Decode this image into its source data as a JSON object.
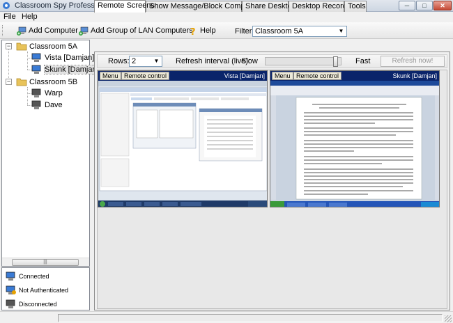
{
  "window": {
    "title": "Classroom Spy Professional",
    "min_glyph": "─",
    "max_glyph": "□",
    "close_glyph": "✕"
  },
  "menu": [
    "File",
    "Help"
  ],
  "toolbar": {
    "add_computer": "Add Computer",
    "add_group": "Add Group of LAN Computers",
    "help": "Help",
    "filter_label": "Filter:",
    "filter_value": "Classroom 5A"
  },
  "tree": {
    "groups": [
      {
        "label": "Classroom 5A",
        "computers": [
          "Vista [Damjan]",
          "Skunk [Damjan]"
        ]
      },
      {
        "label": "Classroom 5B",
        "computers": [
          "Warp",
          "Dave"
        ]
      }
    ],
    "selected": "Skunk [Damjan]"
  },
  "legend": [
    "Connected",
    "Not Authenticated",
    "Disconnected"
  ],
  "tabs": [
    "Remote Screens",
    "Show Message/Block Computers",
    "Share Desktop",
    "Desktop Recorder",
    "Tools"
  ],
  "active_tab": "Remote Screens",
  "screens_toolbar": {
    "rows_label": "Rows:",
    "rows_value": "2",
    "interval_label": "Refresh interval (live):",
    "slow_label": "Slow",
    "fast_label": "Fast",
    "refresh_label": "Refresh now!",
    "slider_position": 0.96
  },
  "screens": [
    {
      "menu_label": "Menu",
      "remote_label": "Remote control",
      "name": "Vista [Damjan]"
    },
    {
      "menu_label": "Menu",
      "remote_label": "Remote control",
      "name": "Skunk [Damjan]"
    }
  ],
  "colors": {
    "selection": "#0a246a",
    "connected": "#3a7bd5",
    "folder": "#e8c35a"
  }
}
